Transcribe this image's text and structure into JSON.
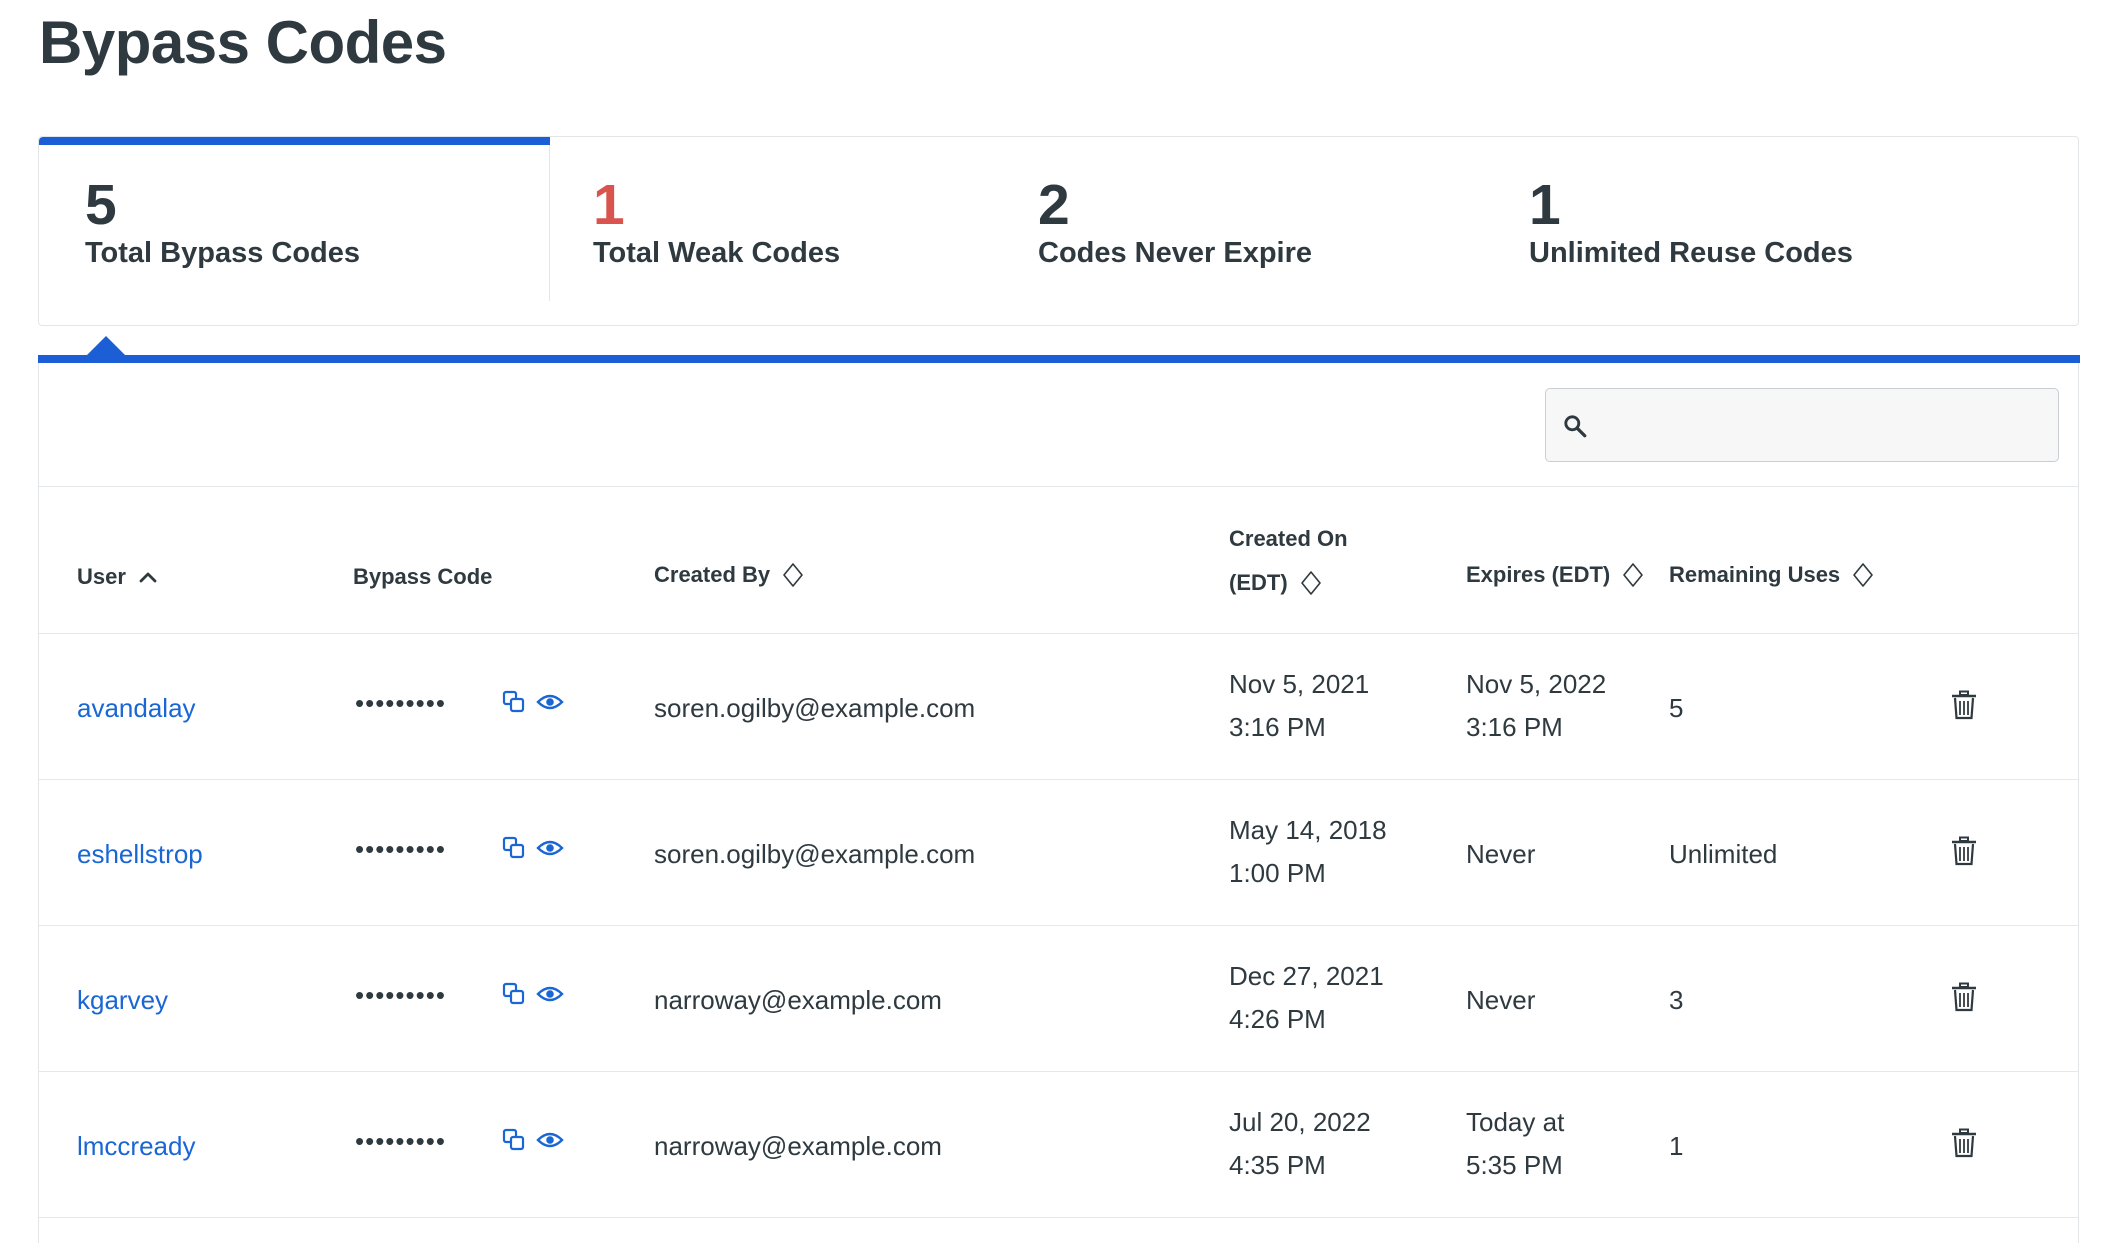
{
  "page": {
    "title": "Bypass Codes"
  },
  "stats": [
    {
      "value": "5",
      "label": "Total Bypass Codes"
    },
    {
      "value": "1",
      "label": "Total Weak Codes"
    },
    {
      "value": "2",
      "label": "Codes Never Expire"
    },
    {
      "value": "1",
      "label": "Unlimited Reuse Codes"
    }
  ],
  "search": {
    "value": "",
    "placeholder": ""
  },
  "table": {
    "headers": {
      "user": "User",
      "code": "Bypass Code",
      "created_by": "Created By",
      "created_on_1": "Created On",
      "created_on_2": "(EDT)",
      "expires": "Expires (EDT)",
      "remaining": "Remaining Uses"
    },
    "rows": [
      {
        "user": "avandalay",
        "code": "•••••••••",
        "created_by": "soren.ogilby@example.com",
        "created_1": "Nov 5, 2021",
        "created_2": "3:16 PM",
        "expires_1": "Nov 5, 2022",
        "expires_2": "3:16 PM",
        "remaining": "5"
      },
      {
        "user": "eshellstrop",
        "code": "•••••••••",
        "created_by": "soren.ogilby@example.com",
        "created_1": "May 14, 2018",
        "created_2": "1:00 PM",
        "expires_1": "Never",
        "expires_2": "",
        "remaining": "Unlimited"
      },
      {
        "user": "kgarvey",
        "code": "•••••••••",
        "created_by": "narroway@example.com",
        "created_1": "Dec 27, 2021",
        "created_2": "4:26 PM",
        "expires_1": "Never",
        "expires_2": "",
        "remaining": "3"
      },
      {
        "user": "lmccready",
        "code": "•••••••••",
        "created_by": "narroway@example.com",
        "created_1": "Jul 20, 2022",
        "created_2": "4:35 PM",
        "expires_1": "Today at",
        "expires_2": "5:35 PM",
        "remaining": "1"
      }
    ]
  },
  "colors": {
    "accent": "#1c5ed6",
    "link": "#1a66d4",
    "weak": "#d9534f",
    "text": "#2f3a40"
  },
  "icons": {
    "search": "search-icon",
    "sort_asc": "chevron-up-icon",
    "sort": "sort-icon",
    "copy": "copy-icon",
    "reveal": "eye-icon",
    "delete": "trash-icon"
  }
}
